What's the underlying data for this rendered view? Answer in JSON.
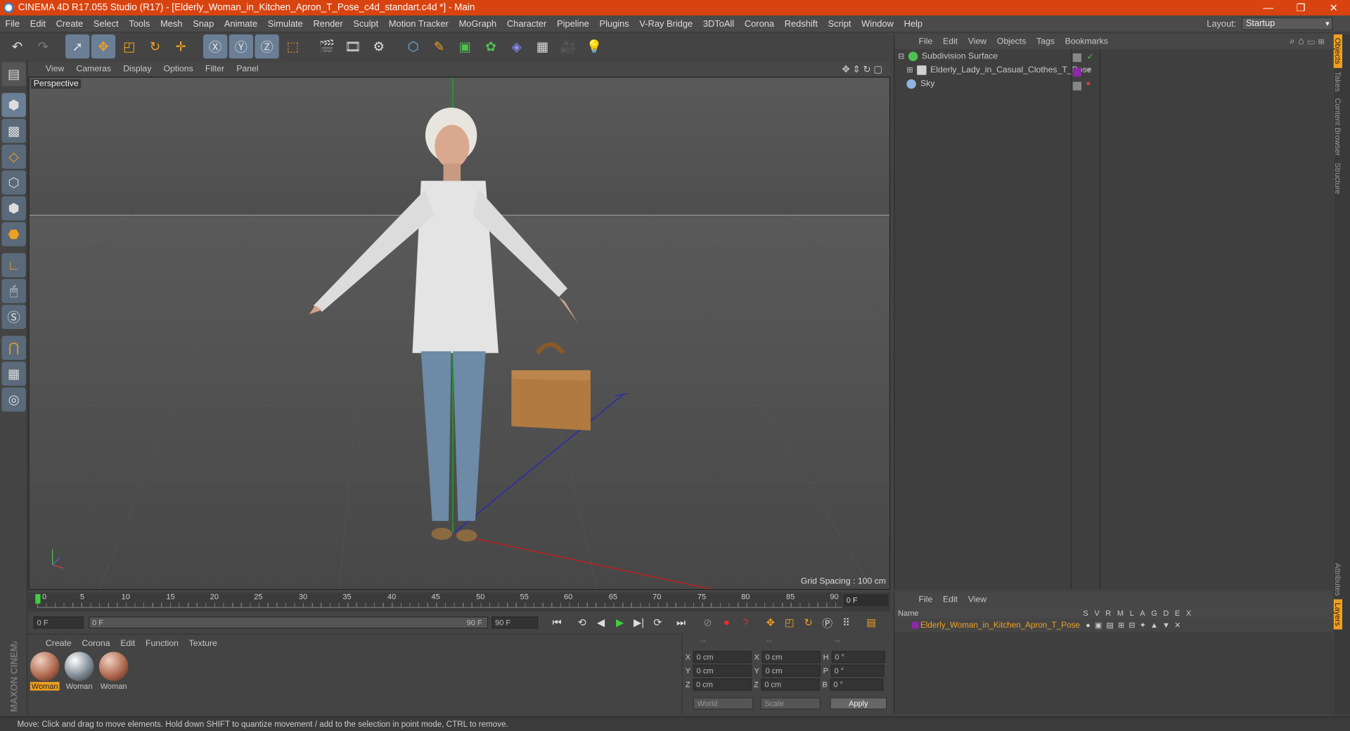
{
  "window": {
    "title": "CINEMA 4D R17.055 Studio (R17) - [Elderly_Woman_in_Kitchen_Apron_T_Pose_c4d_standart.c4d *] - Main"
  },
  "menu": [
    "File",
    "Edit",
    "Create",
    "Select",
    "Tools",
    "Mesh",
    "Snap",
    "Animate",
    "Simulate",
    "Render",
    "Sculpt",
    "Motion Tracker",
    "MoGraph",
    "Character",
    "Pipeline",
    "Plugins",
    "V-Ray Bridge",
    "3DToAll",
    "Corona",
    "Redshift",
    "Script",
    "Window",
    "Help"
  ],
  "layout": {
    "label": "Layout:",
    "value": "Startup"
  },
  "viewport": {
    "menu": [
      "View",
      "Cameras",
      "Display",
      "Options",
      "Filter",
      "Panel"
    ],
    "label": "Perspective",
    "grid_spacing": "Grid Spacing : 100 cm"
  },
  "timeline": {
    "ticks": [
      "0",
      "5",
      "10",
      "15",
      "20",
      "25",
      "30",
      "35",
      "40",
      "45",
      "50",
      "55",
      "60",
      "65",
      "70",
      "75",
      "80",
      "85",
      "90"
    ],
    "current_frame": "0 F"
  },
  "transport": {
    "start": "0 F",
    "range_start": "0 F",
    "range_end": "90 F",
    "end": "90 F"
  },
  "materials": {
    "menu": [
      "Create",
      "Corona",
      "Edit",
      "Function",
      "Texture"
    ],
    "items": [
      {
        "name": "Woman",
        "selected": true
      },
      {
        "name": "Woman",
        "selected": false
      },
      {
        "name": "Woman",
        "selected": false
      }
    ]
  },
  "coords": {
    "headers": [
      "--",
      "--",
      "--"
    ],
    "rows": [
      {
        "a": "X",
        "av": "0 cm",
        "b": "X",
        "bv": "0 cm",
        "c": "H",
        "cv": "0 °"
      },
      {
        "a": "Y",
        "av": "0 cm",
        "b": "Y",
        "bv": "0 cm",
        "c": "P",
        "cv": "0 °"
      },
      {
        "a": "Z",
        "av": "0 cm",
        "b": "Z",
        "bv": "0 cm",
        "c": "B",
        "cv": "0 °"
      }
    ],
    "world": "World",
    "scale": "Scale",
    "apply": "Apply"
  },
  "object_manager": {
    "menu": [
      "File",
      "Edit",
      "View",
      "Objects",
      "Tags",
      "Bookmarks"
    ],
    "objects": [
      {
        "name": "Subdivision Surface",
        "color": "#4ec04e"
      },
      {
        "name": "Elderly_Lady_in_Casual_Clothes_T_Pose",
        "color": "#cfcfcf"
      },
      {
        "name": "Sky",
        "color": "#8fb4e0"
      }
    ]
  },
  "layer_manager": {
    "menu": [
      "File",
      "Edit",
      "View"
    ],
    "name_header": "Name",
    "columns": [
      "S",
      "V",
      "R",
      "M",
      "L",
      "A",
      "G",
      "D",
      "E",
      "X"
    ],
    "layer": "Elderly_Woman_in_Kitchen_Apron_T_Pose"
  },
  "side_tabs": [
    "Objects",
    "Takes",
    "Content Browser",
    "Structure",
    "Attributes",
    "Layers"
  ],
  "status": "Move: Click and drag to move elements. Hold down SHIFT to quantize movement / add to the selection in point mode, CTRL to remove.",
  "brand": "MAXON CINEMA 4D"
}
